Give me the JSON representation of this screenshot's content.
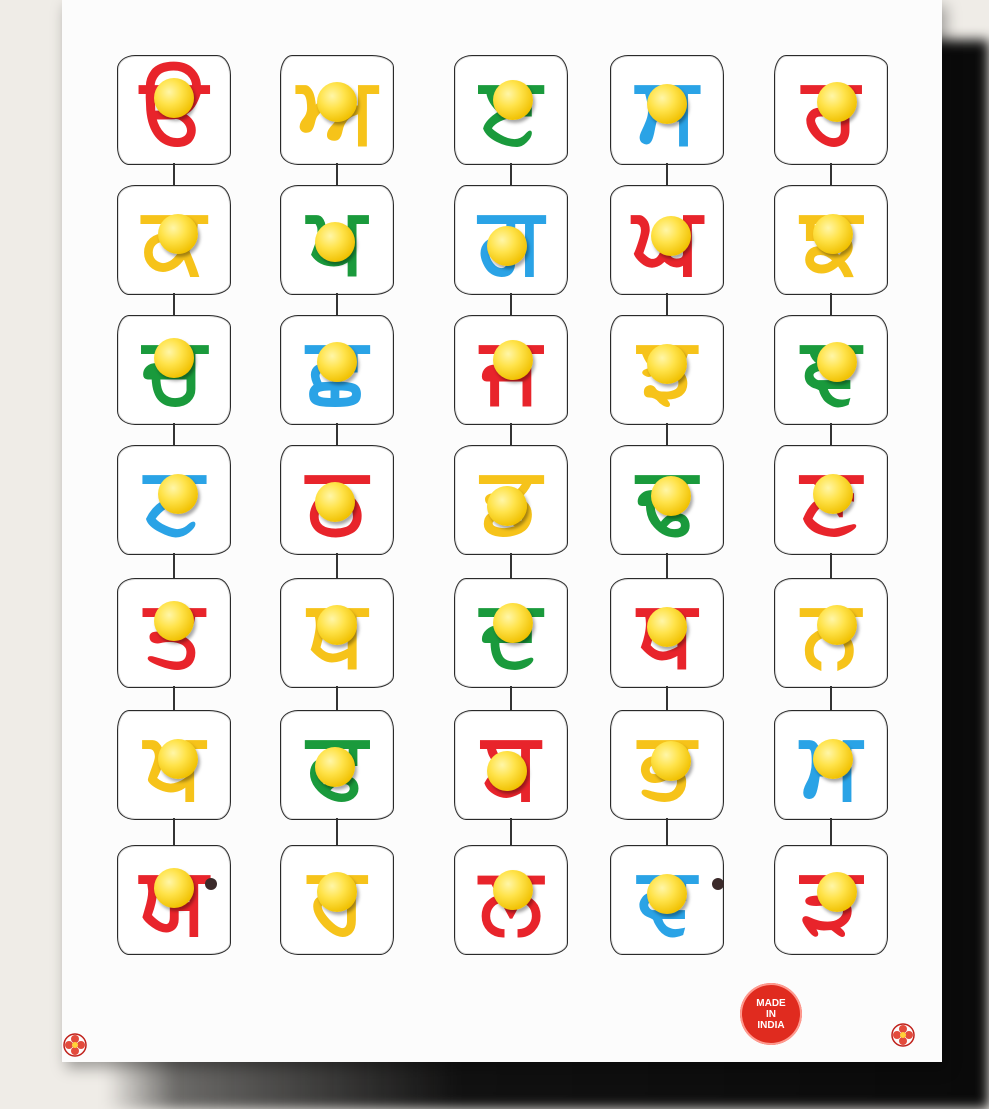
{
  "colors": {
    "red": "#e8242b",
    "yellow": "#f6c31a",
    "green": "#1a9a3c",
    "blue": "#2aa3e6"
  },
  "letters": [
    {
      "char": "ੳ",
      "color": "#e8242b"
    },
    {
      "char": "ਅ",
      "color": "#f6c31a"
    },
    {
      "char": "ੲ",
      "color": "#1a9a3c"
    },
    {
      "char": "ਸ",
      "color": "#2aa3e6"
    },
    {
      "char": "ਹ",
      "color": "#e8242b"
    },
    {
      "char": "ਕ",
      "color": "#f6c31a"
    },
    {
      "char": "ਖ",
      "color": "#1a9a3c"
    },
    {
      "char": "ਗ",
      "color": "#2aa3e6"
    },
    {
      "char": "ਘ",
      "color": "#e8242b"
    },
    {
      "char": "ਙ",
      "color": "#f6c31a"
    },
    {
      "char": "ਚ",
      "color": "#1a9a3c"
    },
    {
      "char": "ਛ",
      "color": "#2aa3e6"
    },
    {
      "char": "ਜ",
      "color": "#e8242b"
    },
    {
      "char": "ਝ",
      "color": "#f6c31a"
    },
    {
      "char": "ਞ",
      "color": "#1a9a3c"
    },
    {
      "char": "ਟ",
      "color": "#2aa3e6"
    },
    {
      "char": "ਠ",
      "color": "#e8242b"
    },
    {
      "char": "ਡ",
      "color": "#f6c31a"
    },
    {
      "char": "ਢ",
      "color": "#1a9a3c"
    },
    {
      "char": "ਣ",
      "color": "#e8242b"
    },
    {
      "char": "ਤ",
      "color": "#e8242b"
    },
    {
      "char": "ਥ",
      "color": "#f6c31a"
    },
    {
      "char": "ਦ",
      "color": "#1a9a3c"
    },
    {
      "char": "ਧ",
      "color": "#e8242b"
    },
    {
      "char": "ਨ",
      "color": "#f6c31a"
    },
    {
      "char": "ਪ",
      "color": "#f6c31a"
    },
    {
      "char": "ਫ",
      "color": "#1a9a3c"
    },
    {
      "char": "ਬ",
      "color": "#e8242b"
    },
    {
      "char": "ਭ",
      "color": "#f6c31a"
    },
    {
      "char": "ਮ",
      "color": "#2aa3e6"
    },
    {
      "char": "ਯ",
      "color": "#e8242b"
    },
    {
      "char": "ਰ",
      "color": "#f6c31a"
    },
    {
      "char": "ਲ",
      "color": "#e8242b"
    },
    {
      "char": "ਵ",
      "color": "#2aa3e6"
    },
    {
      "char": "ੜ",
      "color": "#e8242b"
    }
  ],
  "badge": {
    "line1": "MADE",
    "line2": "IN",
    "line3": "INDIA"
  }
}
